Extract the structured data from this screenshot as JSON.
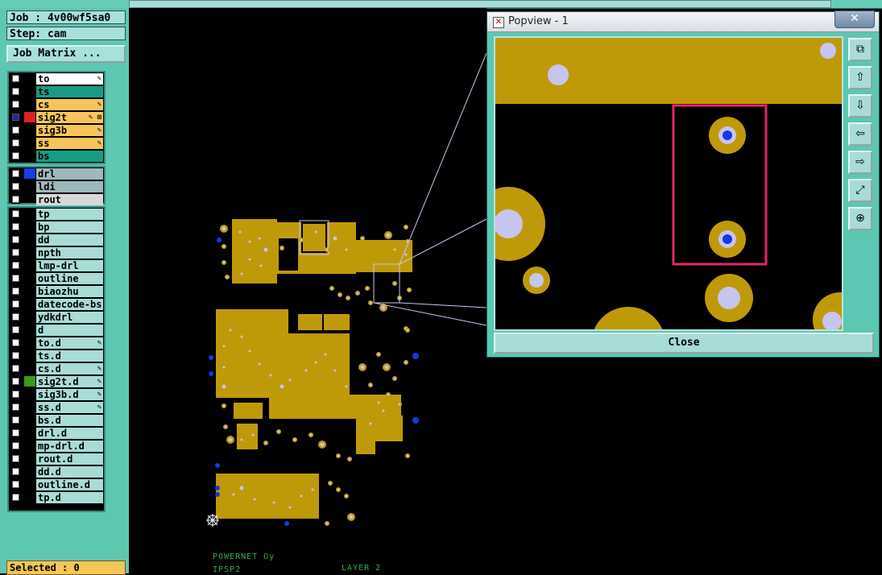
{
  "header": {
    "job_label": "Job : 4v00wf5sa0",
    "step_label": "Step: cam",
    "job_matrix_button": "Job Matrix ..."
  },
  "layers": [
    {
      "name": "to",
      "color": "#ffffff",
      "edit": true,
      "mark": "✎"
    },
    {
      "name": "ts",
      "color": "#199c82",
      "edit": false,
      "mark": ""
    },
    {
      "name": "cs",
      "color": "#f7c559",
      "edit": true,
      "mark": "✎"
    },
    {
      "name": "sig2t",
      "color": "#f7c559",
      "edit": true,
      "mark": "✎ ⊞",
      "swatch": "#e02020",
      "selected": true
    },
    {
      "name": "sig3b",
      "color": "#f7c559",
      "edit": true,
      "mark": "✎"
    },
    {
      "name": "ss",
      "color": "#f7c559",
      "edit": true,
      "mark": "✎"
    },
    {
      "name": "bs",
      "color": "#199c82",
      "edit": false,
      "mark": ""
    }
  ],
  "drill_layers": [
    {
      "name": "drl",
      "color": "#9fb8bc",
      "swatch": "#1540e0"
    },
    {
      "name": "ldi",
      "color": "#9fb8bc"
    },
    {
      "name": "rout",
      "color": "#d8d8d8"
    }
  ],
  "misc_layers": [
    {
      "name": "tp",
      "mark": ""
    },
    {
      "name": "bp",
      "mark": ""
    },
    {
      "name": "dd",
      "mark": ""
    },
    {
      "name": "npth",
      "mark": ""
    },
    {
      "name": "lmp-drl",
      "mark": ""
    },
    {
      "name": "outline",
      "mark": ""
    },
    {
      "name": "biaozhu",
      "mark": ""
    },
    {
      "name": "datecode-bs",
      "mark": ""
    },
    {
      "name": "ydkdrl",
      "mark": ""
    },
    {
      "name": "d",
      "mark": ""
    },
    {
      "name": "to.d",
      "mark": "✎"
    },
    {
      "name": "ts.d",
      "mark": ""
    },
    {
      "name": "cs.d",
      "mark": "✎"
    },
    {
      "name": "sig2t.d",
      "mark": "✎",
      "swatch": "#3a9a1a"
    },
    {
      "name": "sig3b.d",
      "mark": "✎"
    },
    {
      "name": "ss.d",
      "mark": "✎"
    },
    {
      "name": "bs.d",
      "mark": ""
    },
    {
      "name": "drl.d",
      "mark": ""
    },
    {
      "name": "mp-drl.d",
      "mark": ""
    },
    {
      "name": "rout.d",
      "mark": ""
    },
    {
      "name": "dd.d",
      "mark": ""
    },
    {
      "name": "outline.d",
      "mark": ""
    },
    {
      "name": "tp.d",
      "mark": ""
    }
  ],
  "status": {
    "selected_label": "Selected : 0"
  },
  "board_labels": {
    "powernet": "POWERNET Oy",
    "ipsp": "IPSP2",
    "layer": "LAYER 2"
  },
  "popview": {
    "title": "Popview - 1",
    "close_x": "✕",
    "close_button": "Close",
    "tools": [
      "⧉",
      "⇧",
      "⇩",
      "⇦",
      "⇨",
      "⤢",
      "⊕"
    ]
  },
  "colors": {
    "copper": "#bf9a08",
    "pad": "#c8c4f0",
    "drill": "#1438e6",
    "highlight": "#e8246b",
    "panel": "#5ec7b2"
  }
}
